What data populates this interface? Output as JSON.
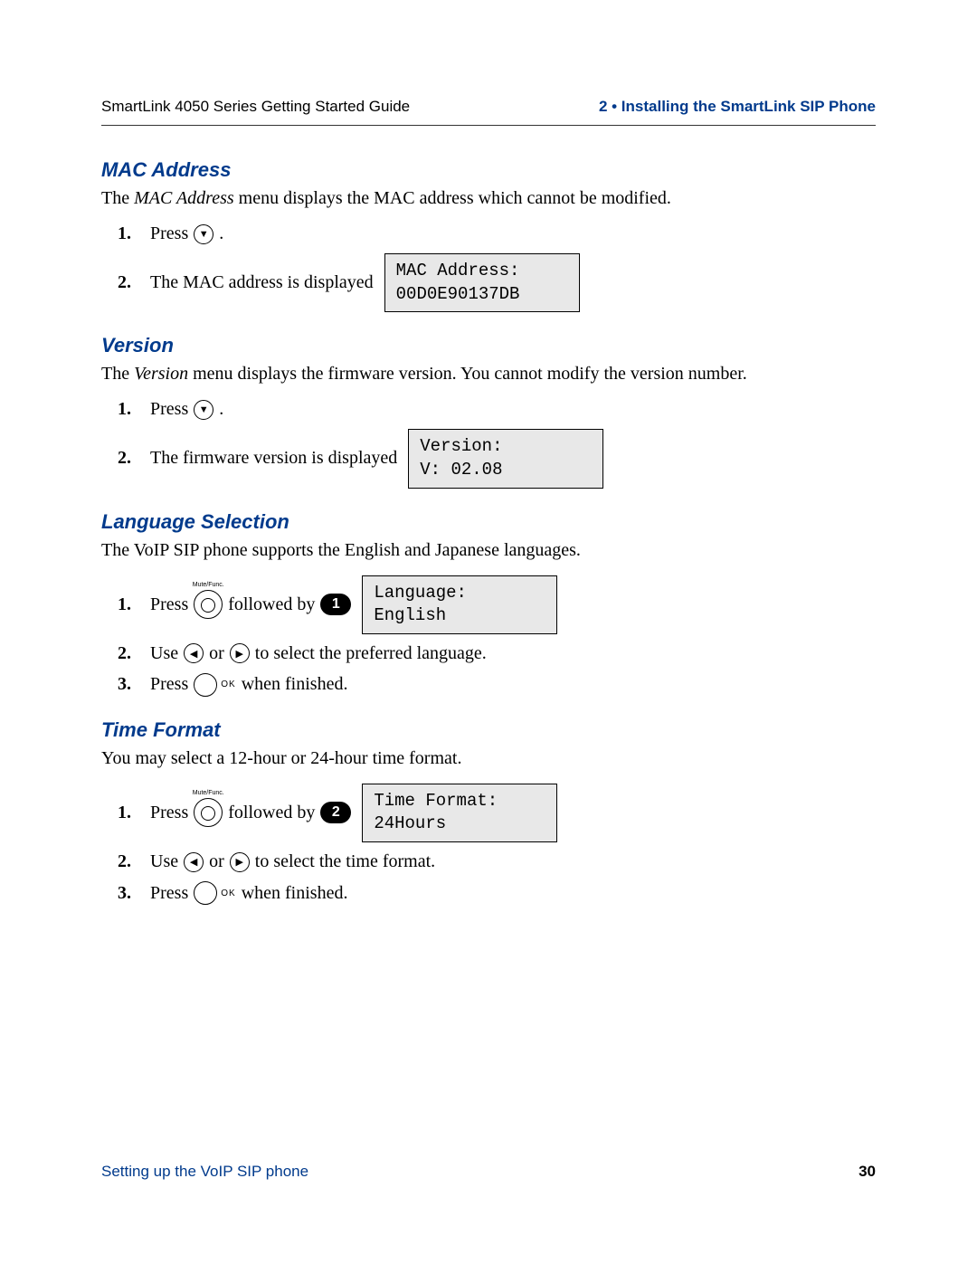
{
  "header": {
    "left": "SmartLink 4050 Series Getting Started Guide",
    "right": "2 • Installing the SmartLink SIP Phone"
  },
  "sections": {
    "mac": {
      "title": "MAC Address",
      "intro_pre": "The ",
      "intro_em": "MAC Address",
      "intro_post": " menu displays the MAC address which cannot be modified.",
      "step1": "Press",
      "step2": "The MAC address is displayed",
      "lcd": "MAC Address:\n00D0E90137DB"
    },
    "version": {
      "title": "Version",
      "intro_pre": "The ",
      "intro_em": "Version",
      "intro_post": " menu displays the firmware version. You cannot modify the version number.",
      "step1": "Press",
      "step2": "The firmware version is displayed",
      "lcd": "Version:\nV: 02.08"
    },
    "lang": {
      "title": "Language Selection",
      "intro": "The VoIP SIP phone supports the English and Japanese languages.",
      "step1a": "Press",
      "step1b": "followed by",
      "key1": "1",
      "lcd": "Language:\nEnglish",
      "step2a": "Use",
      "step2b": "or",
      "step2c": "to select the preferred language.",
      "step3a": "Press",
      "step3b": "when finished."
    },
    "time": {
      "title": "Time Format",
      "intro": "You may select a 12-hour or 24-hour time format.",
      "step1a": "Press",
      "step1b": "followed by",
      "key2": "2",
      "lcd": "Time Format:\n24Hours",
      "step2a": "Use",
      "step2b": "or",
      "step2c": "to select the time format.",
      "step3a": "Press",
      "step3b": "when finished."
    }
  },
  "labels": {
    "mute": "Mute/Func.",
    "ok": "OK",
    "period": "."
  },
  "footer": {
    "left": "Setting up the VoIP SIP phone",
    "page": "30"
  }
}
